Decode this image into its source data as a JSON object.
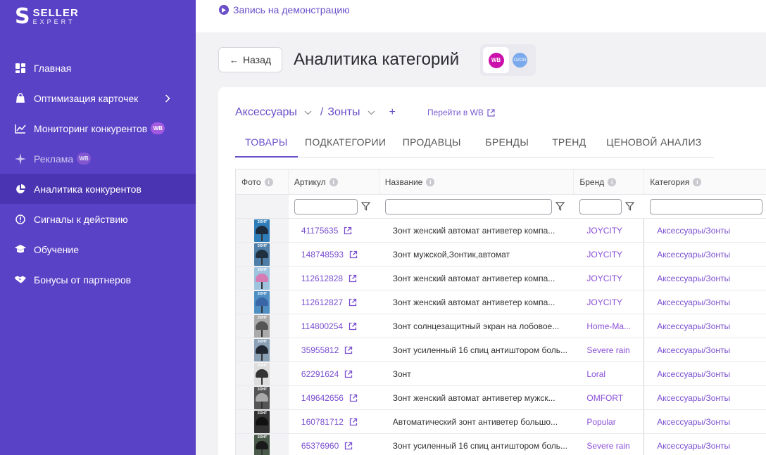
{
  "brand": {
    "logo_mark": "S",
    "line1": "SELLER",
    "line2": "EXPERT"
  },
  "sidebar": {
    "items": [
      {
        "label": "Главная",
        "icon": "dashboard-icon"
      },
      {
        "label": "Оптимизация карточек",
        "icon": "bag-icon"
      },
      {
        "label": "Мониторинг конкурентов",
        "icon": "chart-line-icon",
        "badge": "WB"
      },
      {
        "label": "Реклама",
        "icon": "sparkle-icon",
        "badge": "WB"
      },
      {
        "label": "Аналитика конкурентов",
        "icon": "pie-chart-icon"
      },
      {
        "label": "Сигналы к действию",
        "icon": "alert-icon"
      },
      {
        "label": "Обучение",
        "icon": "graduation-cap-icon"
      },
      {
        "label": "Бонусы от партнеров",
        "icon": "handshake-icon"
      }
    ]
  },
  "topbar": {
    "demo_link": "Запись на демонстрацию"
  },
  "header": {
    "back_label": "Назад",
    "title": "Аналитика категорий",
    "marketplaces": [
      "WB",
      "OZON"
    ]
  },
  "breadcrumb": {
    "level1": "Аксессуары",
    "level2": "Зонты",
    "wb_link": "Перейти в WB"
  },
  "tabs": [
    "ТОВАРЫ",
    "ПОДКАТЕГОРИИ",
    "ПРОДАВЦЫ",
    "БРЕНДЫ",
    "ТРЕНД",
    "ЦЕНОВОЙ АНАЛИЗ"
  ],
  "table": {
    "columns": [
      "Фото",
      "Артикул",
      "Название",
      "Бренд",
      "Категория"
    ],
    "rows": [
      {
        "sku": "41175635",
        "name": "Зонт женский автомат антиветер компа...",
        "brand": "JOYCITY",
        "category": "Аксессуары/Зонты"
      },
      {
        "sku": "148748593",
        "name": "Зонт мужской,Зонтик,автомат",
        "brand": "JOYCITY",
        "category": "Аксессуары/Зонты"
      },
      {
        "sku": "112612828",
        "name": "Зонт женский автомат антиветер компа...",
        "brand": "JOYCITY",
        "category": "Аксессуары/Зонты"
      },
      {
        "sku": "112612827",
        "name": "Зонт женский автомат антиветер компа...",
        "brand": "JOYCITY",
        "category": "Аксессуары/Зонты"
      },
      {
        "sku": "114800254",
        "name": "Зонт солнцезащитный экран на лобовое...",
        "brand": "Home-Ma...",
        "category": "Аксессуары/Зонты"
      },
      {
        "sku": "35955812",
        "name": "Зонт усиленный 16 спиц антиштором боль...",
        "brand": "Severe rain",
        "category": "Аксессуары/Зонты"
      },
      {
        "sku": "62291624",
        "name": "Зонт",
        "brand": "Loral",
        "category": "Аксессуары/Зонты"
      },
      {
        "sku": "149642656",
        "name": "Зонт женский автомат антиветер мужск...",
        "brand": "OMFORT",
        "category": "Аксессуары/Зонты"
      },
      {
        "sku": "160781712",
        "name": "Автоматический зонт антиветер большо...",
        "brand": "Popular",
        "category": "Аксессуары/Зонты"
      },
      {
        "sku": "65376960",
        "name": "Зонт усиленный 16 спиц антиштором боль...",
        "brand": "Severe rain",
        "category": "Аксессуары/Зонты"
      }
    ],
    "thumbnail_text": "ЗОНТ"
  },
  "colors": {
    "sidebar_bg": "#5942c6",
    "accent": "#6a4fc9",
    "wb": "#cb11ab",
    "ozon": "#7aa9ec"
  }
}
